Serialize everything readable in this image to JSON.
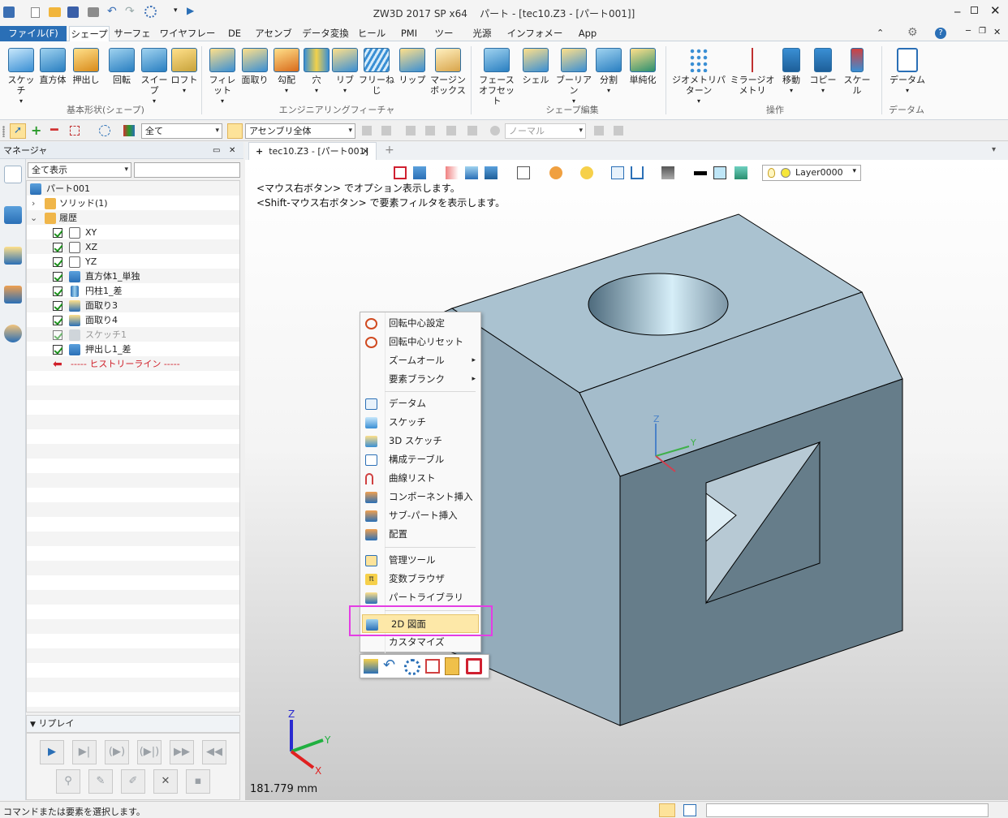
{
  "window": {
    "title": "ZW3D 2017 SP x64",
    "doc_title": "パート - [tec10.Z3 - [パート001]]"
  },
  "menu": {
    "tabs": [
      "ファイル(F)",
      "シェープ",
      "サーフェス",
      "ワイヤフレーム",
      "DE",
      "アセンブリ",
      "データ変換",
      "ヒール",
      "PMI",
      "ツール",
      "光源",
      "インフォメーション",
      "App"
    ]
  },
  "ribbon": {
    "buttons": [
      "スケッチ",
      "直方体",
      "押出し",
      "回転",
      "スイープ",
      "ロフト",
      "フィレット",
      "面取り",
      "勾配",
      "穴",
      "リブ",
      "フリーねじ",
      "リップ",
      "マージン\nボックス",
      "フェース\nオフセット",
      "シェル",
      "ブーリアン",
      "分割",
      "単純化",
      "ジオメトリパターン",
      "ミラージオメトリ",
      "移動",
      "コピー",
      "スケール",
      "データム"
    ],
    "groups": [
      "基本形状(シェープ)",
      "エンジニアリングフィーチャ",
      "シェープ編集",
      "操作",
      "データム"
    ]
  },
  "toolbar2": {
    "filter": "全て",
    "scope": "アセンブリ全体",
    "mode": "ノーマル"
  },
  "manager": {
    "title": "マネージャ",
    "display_filter": "全て表示",
    "root": "パート001",
    "nodes": [
      "ソリッド(1)",
      "履歴",
      "XY",
      "XZ",
      "YZ",
      "直方体1_単独",
      "円柱1_差",
      "面取り3",
      "面取り4",
      "スケッチ1",
      "押出し1_差",
      "----- ヒストリーライン -----"
    ]
  },
  "replay": {
    "title": "リプレイ"
  },
  "doc_tab": {
    "label": "tec10.Z3 - [パート001]"
  },
  "viewport": {
    "layer": "Layer0000",
    "hint1": "<マウス右ボタン> でオプション表示します。",
    "hint2": "<Shift-マウス右ボタン> で要素フィルタを表示します。",
    "scale": "181.779 mm",
    "axis_x": "X",
    "axis_y": "Y",
    "axis_z": "Z"
  },
  "context_menu": {
    "items": [
      "回転中心設定",
      "回転中心リセット",
      "ズームオール",
      "要素ブランク",
      "データム",
      "スケッチ",
      "3D スケッチ",
      "構成テーブル",
      "曲線リスト",
      "コンポーネント挿入",
      "サブ-パート挿入",
      "配置",
      "管理ツール",
      "変数ブラウザ",
      "パートライブラリ",
      "2D 図面",
      "カスタマイズ"
    ],
    "highlighted": "2D 図面"
  },
  "status": {
    "text": "コマンドまたは要素を選択します。"
  },
  "colors": {
    "accent": "#2a6fb6",
    "model_face": "#a4bccb",
    "highlight_box": "#e43de4"
  }
}
